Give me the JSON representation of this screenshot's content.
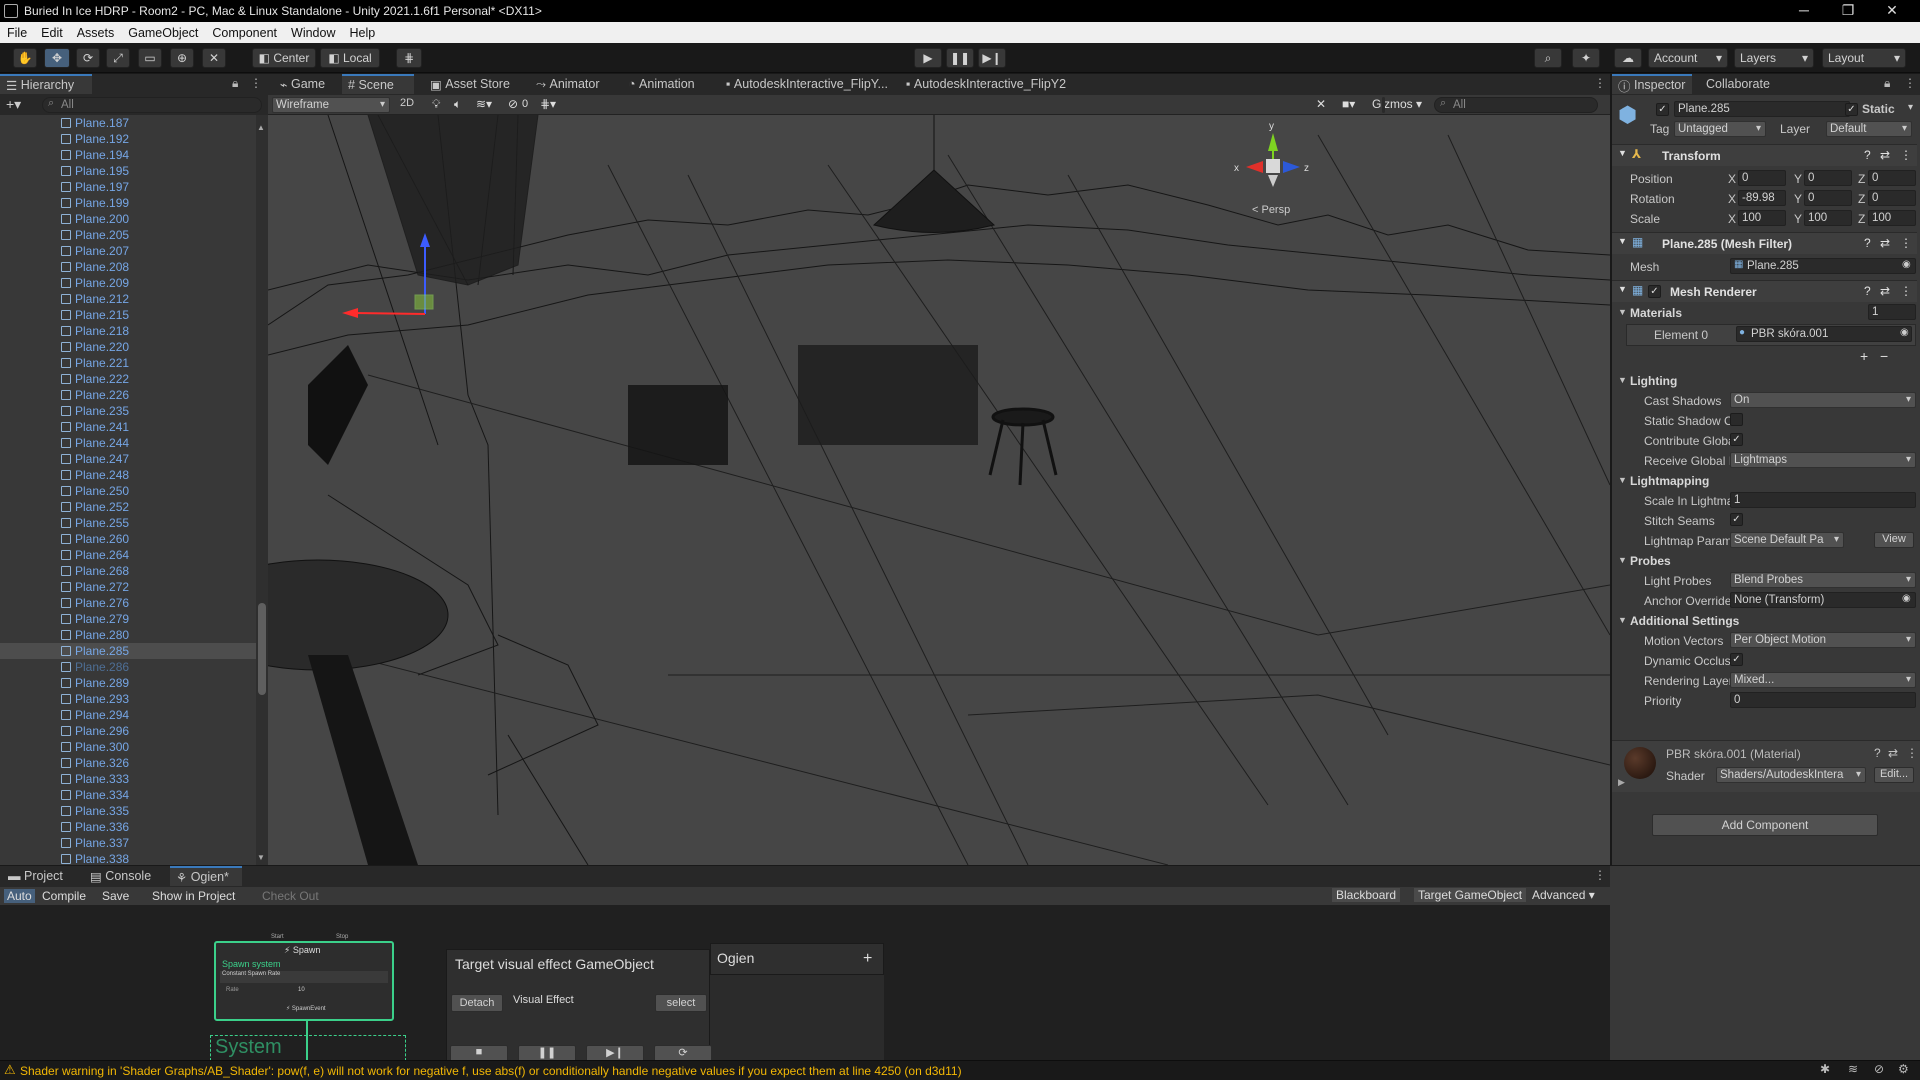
{
  "window": {
    "title": "Buried In Ice HDRP - Room2 - PC, Mac & Linux Standalone - Unity 2021.1.6f1 Personal* <DX11>",
    "minimize": "─",
    "maximize": "❐",
    "close": "✕"
  },
  "menu": [
    "File",
    "Edit",
    "Assets",
    "GameObject",
    "Component",
    "Window",
    "Help"
  ],
  "toolbar": {
    "pivot": "Center",
    "space": "Local",
    "account": "Account",
    "layers": "Layers",
    "layout": "Layout"
  },
  "hierarchy": {
    "tab": "Hierarchy",
    "search": "All",
    "selected": "Plane.285",
    "items": [
      "Plane.187",
      "Plane.192",
      "Plane.194",
      "Plane.195",
      "Plane.197",
      "Plane.199",
      "Plane.200",
      "Plane.205",
      "Plane.207",
      "Plane.208",
      "Plane.209",
      "Plane.212",
      "Plane.215",
      "Plane.218",
      "Plane.220",
      "Plane.221",
      "Plane.222",
      "Plane.226",
      "Plane.235",
      "Plane.241",
      "Plane.244",
      "Plane.247",
      "Plane.248",
      "Plane.250",
      "Plane.252",
      "Plane.255",
      "Plane.260",
      "Plane.264",
      "Plane.268",
      "Plane.272",
      "Plane.276",
      "Plane.279",
      "Plane.280",
      "Plane.285",
      "Plane.286",
      "Plane.289",
      "Plane.293",
      "Plane.294",
      "Plane.296",
      "Plane.300",
      "Plane.326",
      "Plane.333",
      "Plane.334",
      "Plane.335",
      "Plane.336",
      "Plane.337",
      "Plane.338"
    ]
  },
  "scene_tabs": [
    "Game",
    "Scene",
    "Asset Store",
    "Animator",
    "Animation",
    "AutodeskInteractive_FlipY...",
    "AutodeskInteractive_FlipY2"
  ],
  "scene_toolbar": {
    "draw_mode": "Wireframe",
    "mode_2d": "2D",
    "hidden_count": "0",
    "gizmos": "Gizmos",
    "search": "All",
    "persp": "< Persp",
    "axes": [
      "x",
      "y",
      "z"
    ]
  },
  "inspector": {
    "tabs": [
      "Inspector",
      "Collaborate"
    ],
    "object_name": "Plane.285",
    "static": "Static",
    "tag_label": "Tag",
    "tag": "Untagged",
    "layer_label": "Layer",
    "layer": "Default",
    "transform": {
      "title": "Transform",
      "position": {
        "label": "Position",
        "x": "0",
        "y": "0",
        "z": "0"
      },
      "rotation": {
        "label": "Rotation",
        "x": "-89.98",
        "y": "0",
        "z": "0"
      },
      "scale": {
        "label": "Scale",
        "x": "100",
        "y": "100",
        "z": "100"
      }
    },
    "mesh_filter": {
      "title": "Plane.285 (Mesh Filter)",
      "mesh_label": "Mesh",
      "mesh": "Plane.285"
    },
    "mesh_renderer": {
      "title": "Mesh Renderer",
      "materials_label": "Materials",
      "materials_count": "1",
      "element0_label": "Element 0",
      "element0": "PBR skóra.001",
      "lighting": "Lighting",
      "cast_shadows_label": "Cast Shadows",
      "cast_shadows": "On",
      "static_shadow_label": "Static Shadow Cas",
      "contribute_gi_label": "Contribute Global I",
      "receive_gi_label": "Receive Global Illu",
      "receive_gi": "Lightmaps",
      "lightmapping": "Lightmapping",
      "scale_lightmap_label": "Scale In Lightmap",
      "scale_lightmap": "1",
      "stitch_seams_label": "Stitch Seams",
      "lightmap_params_label": "Lightmap Paramete",
      "lightmap_params": "Scene Default Pa",
      "view": "View",
      "probes": "Probes",
      "light_probes_label": "Light Probes",
      "light_probes": "Blend Probes",
      "anchor_override_label": "Anchor Override",
      "anchor_override": "None (Transform)",
      "additional": "Additional Settings",
      "motion_vectors_label": "Motion Vectors",
      "motion_vectors": "Per Object Motion",
      "dynamic_occlusion_label": "Dynamic Occlusior",
      "rendering_layer_label": "Rendering Layer M",
      "rendering_layer": "Mixed...",
      "priority_label": "Priority",
      "priority": "0"
    },
    "material": {
      "title": "PBR skóra.001 (Material)",
      "shader_label": "Shader",
      "shader": "Shaders/AutodeskIntera",
      "edit": "Edit..."
    },
    "add_component": "Add Component"
  },
  "bottom": {
    "tabs": [
      "Project",
      "Console",
      "Ogien*"
    ],
    "toolbar": [
      "Auto",
      "Compile",
      "Save",
      "Show in Project",
      "Check Out"
    ],
    "toolbar_right": [
      "Blackboard",
      "Target GameObject",
      "Advanced"
    ],
    "spawn_node": {
      "title": "Spawn",
      "sub": "Spawn system",
      "row1": "Constant Spawn Rate",
      "row2": "Rate",
      "row2_val": "10",
      "footer": "SpawnEvent",
      "start": "Start",
      "stop": "Stop"
    },
    "system_label": "System",
    "target_panel": {
      "title": "Target visual effect GameObject",
      "detach": "Detach",
      "effect": "Visual Effect",
      "select": "select"
    },
    "ogien_panel": {
      "title": "Ogien",
      "add": "+"
    }
  },
  "status": {
    "message": "Shader warning in 'Shader Graphs/AB_Shader': pow(f, e) will not work for negative f, use abs(f) or conditionally handle negative values if you expect them at line 4250 (on d3d11)"
  },
  "colors": {
    "accent": "#3a79bb",
    "hier_link": "#76a6e5",
    "warning": "#f2b705"
  }
}
